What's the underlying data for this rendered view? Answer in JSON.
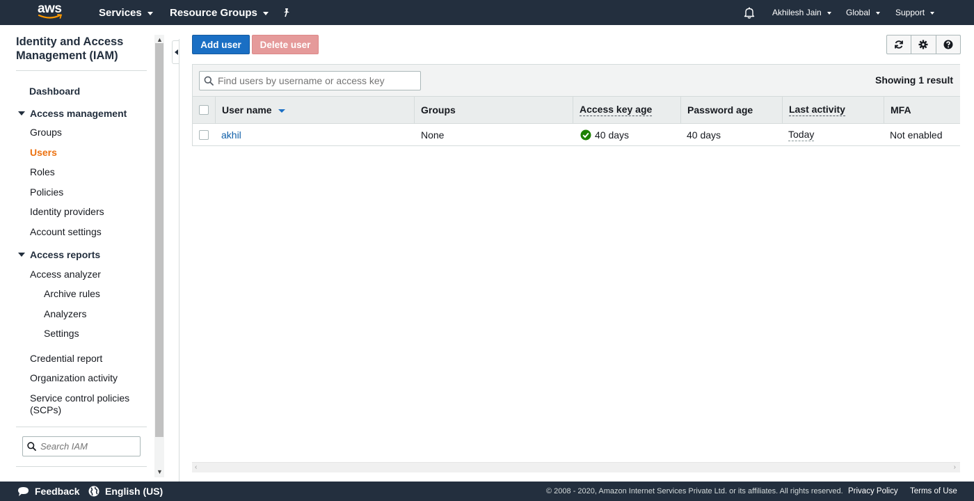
{
  "topnav": {
    "logo": "aws",
    "services": "Services",
    "resource_groups": "Resource Groups",
    "user": "Akhilesh Jain",
    "region": "Global",
    "support": "Support"
  },
  "sidebar": {
    "title": "Identity and Access Management (IAM)",
    "dashboard": "Dashboard",
    "access_management": {
      "label": "Access management",
      "items": [
        "Groups",
        "Users",
        "Roles",
        "Policies",
        "Identity providers",
        "Account settings"
      ]
    },
    "access_reports": {
      "label": "Access reports",
      "analyzer": "Access analyzer",
      "analyzer_items": [
        "Archive rules",
        "Analyzers",
        "Settings"
      ],
      "items": [
        "Credential report",
        "Organization activity",
        "Service control policies (SCPs)"
      ]
    },
    "search_placeholder": "Search IAM"
  },
  "toolbar": {
    "add_user": "Add user",
    "delete_user": "Delete user"
  },
  "table": {
    "search_placeholder": "Find users by username or access key",
    "result_count": "Showing 1 result",
    "columns": [
      "User name",
      "Groups",
      "Access key age",
      "Password age",
      "Last activity",
      "MFA"
    ],
    "rows": [
      {
        "user_name": "akhil",
        "groups": "None",
        "access_key_age": "40 days",
        "password_age": "40 days",
        "last_activity": "Today",
        "mfa": "Not enabled"
      }
    ]
  },
  "footer": {
    "feedback": "Feedback",
    "language": "English (US)",
    "copyright": "© 2008 - 2020, Amazon Internet Services Private Ltd. or its affiliates. All rights reserved.",
    "privacy": "Privacy Policy",
    "terms": "Terms of Use"
  },
  "colors": {
    "nav_bg": "#232f3e",
    "primary": "#1a6fc4",
    "active_link": "#ec7211",
    "danger_disabled": "#e59a9a",
    "success": "#1d8102"
  },
  "icons": [
    "star-pin-icon",
    "bell-icon",
    "refresh-icon",
    "gear-icon",
    "help-icon",
    "search-icon",
    "check-circle-icon",
    "speech-bubble-icon",
    "globe-icon"
  ]
}
